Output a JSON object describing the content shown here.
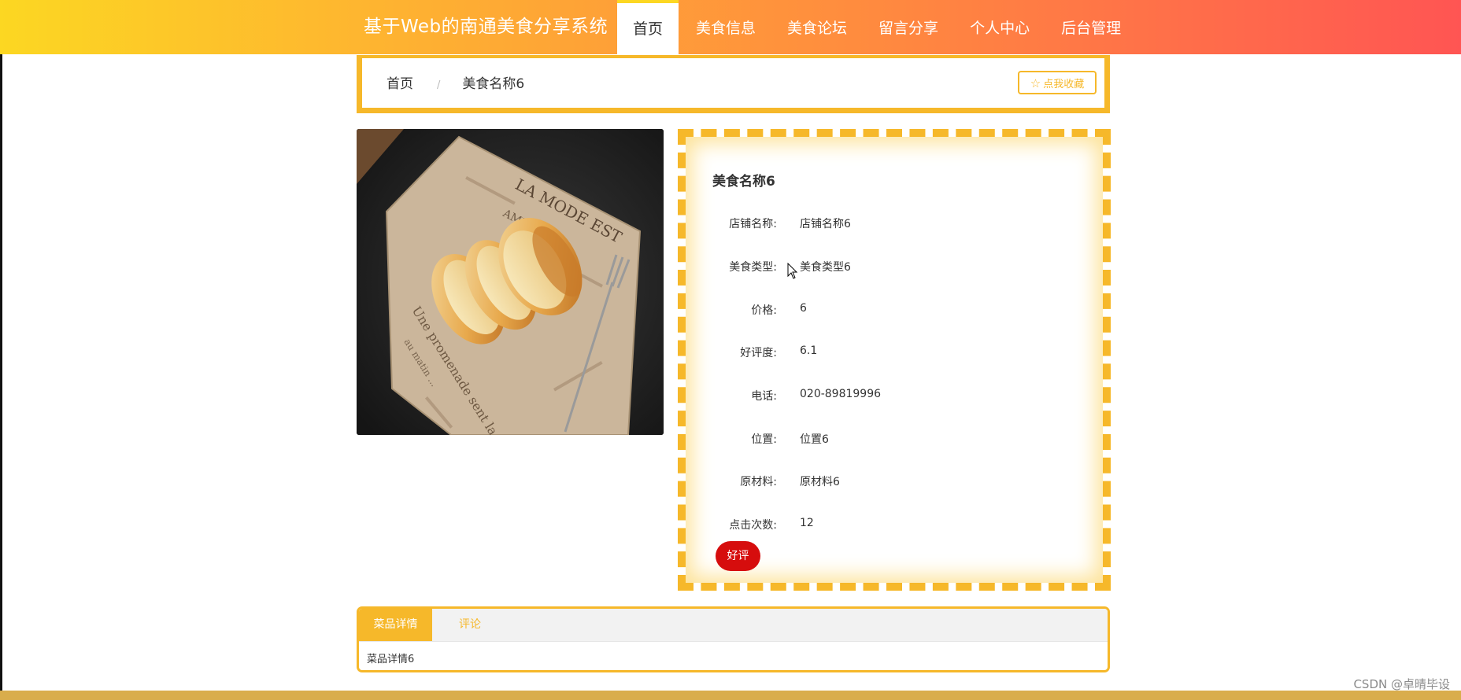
{
  "header": {
    "title": "基于Web的南通美食分享系统",
    "nav": [
      "首页",
      "美食信息",
      "美食论坛",
      "留言分享",
      "个人中心",
      "后台管理"
    ],
    "active_nav": "首页"
  },
  "breadcrumb": {
    "home": "首页",
    "separator": "/",
    "current": "美食名称6"
  },
  "favorite_button": {
    "icon": "star-outline-icon",
    "label": "点我收藏"
  },
  "food_image": {
    "alt": "bread-on-newspaper-photo"
  },
  "detail": {
    "title": "美食名称6",
    "fields": [
      {
        "label": "店铺名称:",
        "value": "店铺名称6"
      },
      {
        "label": "美食类型:",
        "value": "美食类型6"
      },
      {
        "label": "价格:",
        "value": "6"
      },
      {
        "label": "好评度:",
        "value": "6.1"
      },
      {
        "label": "电话:",
        "value": "020-89819996"
      },
      {
        "label": "位置:",
        "value": "位置6"
      },
      {
        "label": "原材料:",
        "value": "原材料6"
      },
      {
        "label": "点击次数:",
        "value": "12"
      }
    ],
    "good_button": "好评"
  },
  "tabs": {
    "items": [
      "菜品详情",
      "评论"
    ],
    "content": "菜品详情6"
  },
  "watermark": "CSDN @卓晴毕设",
  "colors": {
    "accent": "#f6b82a",
    "header_start": "#fcd722",
    "header_end": "#ff5553",
    "good_button": "#d60d0d"
  }
}
